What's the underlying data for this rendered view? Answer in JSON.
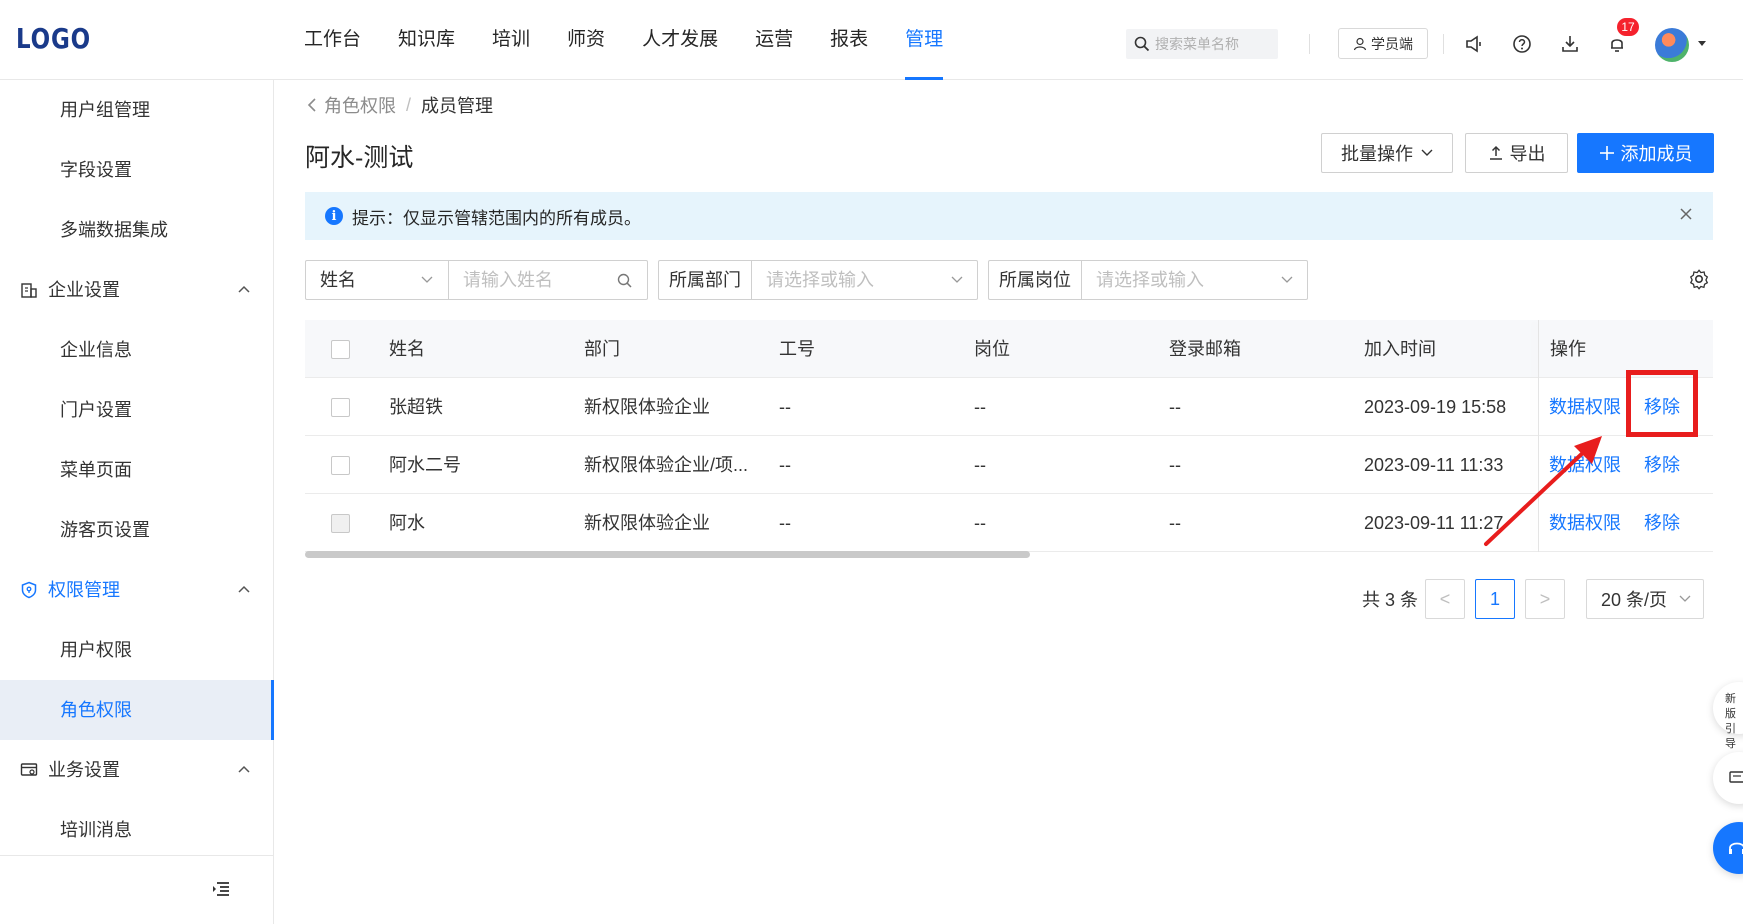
{
  "header": {
    "logo": "LOGO",
    "nav": [
      "工作台",
      "知识库",
      "培训",
      "师资",
      "人才发展",
      "运营",
      "报表",
      "管理"
    ],
    "active_nav": "管理",
    "search_placeholder": "搜索菜单名称",
    "student_label": "学员端",
    "notification_count": "17"
  },
  "sidebar": {
    "items": [
      {
        "label": "用户组管理",
        "type": "item"
      },
      {
        "label": "字段设置",
        "type": "item"
      },
      {
        "label": "多端数据集成",
        "type": "item"
      },
      {
        "label": "企业设置",
        "type": "group",
        "icon": "building-icon"
      },
      {
        "label": "企业信息",
        "type": "item"
      },
      {
        "label": "门户设置",
        "type": "item"
      },
      {
        "label": "菜单页面",
        "type": "item"
      },
      {
        "label": "游客页设置",
        "type": "item"
      },
      {
        "label": "权限管理",
        "type": "group",
        "icon": "shield-icon",
        "active": true
      },
      {
        "label": "用户权限",
        "type": "item"
      },
      {
        "label": "角色权限",
        "type": "item",
        "active": true
      },
      {
        "label": "业务设置",
        "type": "group",
        "icon": "card-settings-icon"
      },
      {
        "label": "培训消息",
        "type": "item"
      }
    ]
  },
  "breadcrumb": {
    "parent": "角色权限",
    "separator": "/",
    "current": "成员管理"
  },
  "page_title": "阿水-测试",
  "actions": {
    "batch": "批量操作",
    "export": "导出",
    "add": "添加成员"
  },
  "alert": {
    "text": "提示：仅显示管辖范围内的所有成员。"
  },
  "filters": {
    "field_select": "姓名",
    "name_placeholder": "请输入姓名",
    "dept_label": "所属部门",
    "dept_placeholder": "请选择或输入",
    "post_label": "所属岗位",
    "post_placeholder": "请选择或输入"
  },
  "table": {
    "columns": [
      "姓名",
      "部门",
      "工号",
      "岗位",
      "登录邮箱",
      "加入时间",
      "操作"
    ],
    "rows": [
      {
        "name": "张超铁",
        "dept": "新权限体验企业",
        "emp_no": "--",
        "post": "--",
        "email": "--",
        "joined": "2023-09-19 15:58",
        "op1": "数据权限",
        "op2": "移除"
      },
      {
        "name": "阿水二号",
        "dept": "新权限体验企业/项...",
        "emp_no": "--",
        "post": "--",
        "email": "--",
        "joined": "2023-09-11 11:33",
        "op1": "数据权限",
        "op2": "移除"
      },
      {
        "name": "阿水",
        "dept": "新权限体验企业",
        "emp_no": "--",
        "post": "--",
        "email": "--",
        "joined": "2023-09-11 11:27",
        "op1": "数据权限",
        "op2": "移除"
      }
    ]
  },
  "pagination": {
    "total": "共 3 条",
    "prev": "<",
    "current": "1",
    "next": ">",
    "page_size": "20 条/页"
  },
  "floating": {
    "news_text": "新版引导"
  },
  "colors": {
    "primary": "#1677ff",
    "annotation": "#e81d1d",
    "alert_bg": "#e6f4fc"
  }
}
